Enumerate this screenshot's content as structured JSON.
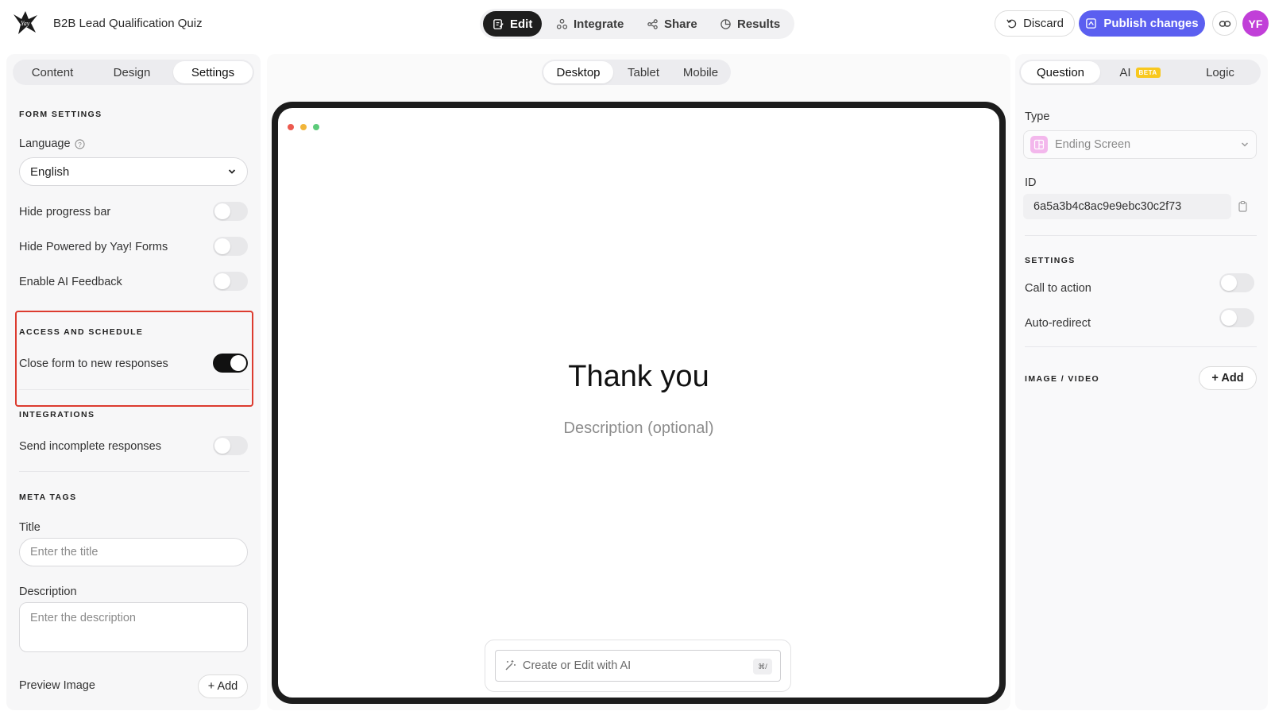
{
  "app": {
    "title": "B2B Lead Qualification Quiz",
    "logo": "yay-logo"
  },
  "nav": {
    "tabs": [
      {
        "label": "Edit",
        "icon": "edit-icon",
        "active": true
      },
      {
        "label": "Integrate",
        "icon": "integrate-icon",
        "active": false
      },
      {
        "label": "Share",
        "icon": "share-icon",
        "active": false
      },
      {
        "label": "Results",
        "icon": "results-icon",
        "active": false
      }
    ]
  },
  "actions": {
    "discard": "Discard",
    "publish": "Publish changes",
    "avatar": "YF"
  },
  "left": {
    "tabs": [
      "Content",
      "Design",
      "Settings"
    ],
    "active_tab": "Settings",
    "form_settings": {
      "title": "FORM SETTINGS",
      "language_label": "Language",
      "language_value": "English",
      "hide_progress_bar": {
        "label": "Hide progress bar",
        "on": false
      },
      "hide_powered": {
        "label": "Hide Powered by Yay! Forms",
        "on": false
      },
      "enable_ai_feedback": {
        "label": "Enable AI Feedback",
        "on": false
      }
    },
    "access": {
      "title": "ACCESS AND SCHEDULE",
      "close_form": {
        "label": "Close form to new responses",
        "on": true
      }
    },
    "integrations": {
      "title": "INTEGRATIONS",
      "send_incomplete": {
        "label": "Send incomplete responses",
        "on": false
      }
    },
    "meta": {
      "title": "META TAGS",
      "title_label": "Title",
      "title_placeholder": "Enter the title",
      "description_label": "Description",
      "description_placeholder": "Enter the description",
      "preview_image_label": "Preview Image",
      "add_label": "+ Add"
    }
  },
  "center": {
    "devices": [
      "Desktop",
      "Tablet",
      "Mobile"
    ],
    "active_device": "Desktop",
    "heading": "Thank you",
    "description": "Description (optional)",
    "ai_placeholder": "Create or Edit with AI",
    "ai_shortcut": "⌘/",
    "window_dot_colors": [
      "#ec5a4f",
      "#f1b53a",
      "#5ccb7a"
    ]
  },
  "right": {
    "tabs": [
      "Question",
      "AI",
      "Logic"
    ],
    "active_tab": "Question",
    "ai_badge": "BETA",
    "type_label": "Type",
    "type_value": "Ending Screen",
    "id_label": "ID",
    "id_value": "6a5a3b4c8ac9e9ebc30c2f73",
    "settings_title": "SETTINGS",
    "call_to_action": {
      "label": "Call to action",
      "on": false
    },
    "auto_redirect": {
      "label": "Auto-redirect",
      "on": false
    },
    "media_title": "IMAGE / VIDEO",
    "add_label": "+ Add"
  },
  "colors": {
    "accent": "#5b5ff0",
    "avatar": "#c13fd8",
    "highlight": "#dc3b2f",
    "beta": "#f8c81f"
  }
}
